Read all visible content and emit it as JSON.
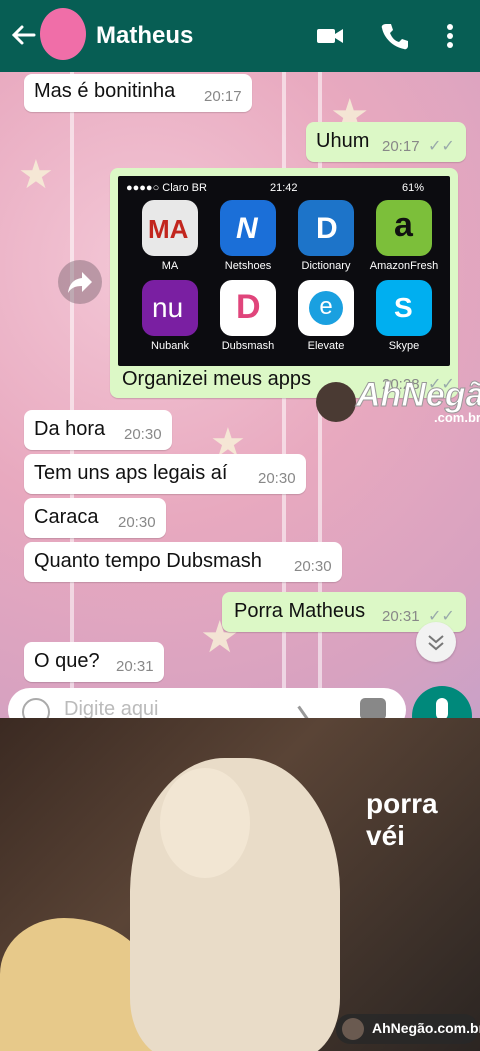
{
  "header": {
    "contact_name": "Matheus",
    "color": "#075e54",
    "icons": [
      "back-arrow-icon",
      "video-call-icon",
      "phone-icon",
      "more-options-icon"
    ]
  },
  "messages": [
    {
      "dir": "in",
      "text": "Mas é bonitinha",
      "time": "20:17"
    },
    {
      "dir": "out",
      "text": "Uhum",
      "time": "20:17",
      "ticks": "✓✓"
    },
    {
      "dir": "out",
      "text": "Organizei meus apps",
      "time": "20:28",
      "ticks": "✓✓",
      "has_image": true
    },
    {
      "dir": "in",
      "text": "Da hora",
      "time": "20:30"
    },
    {
      "dir": "in",
      "text": "Tem uns aps legais aí",
      "time": "20:30"
    },
    {
      "dir": "in",
      "text": "Caraca",
      "time": "20:30"
    },
    {
      "dir": "in",
      "text": "Quanto tempo Dubsmash",
      "time": "20:30"
    },
    {
      "dir": "out",
      "text": "Porra Matheus",
      "time": "20:31",
      "ticks": "✓✓"
    },
    {
      "dir": "in",
      "text": "O que?",
      "time": "20:31"
    }
  ],
  "phone_screenshot": {
    "carrier": "●●●●○ Claro BR",
    "clock": "21:42",
    "battery": "61%",
    "apps": [
      {
        "name": "MA",
        "icon": "MA",
        "color": "#e8e8e8"
      },
      {
        "name": "Netshoes",
        "icon": "N",
        "color": "#1b6fd8"
      },
      {
        "name": "Dictionary",
        "icon": "D",
        "color": "#1d74c9"
      },
      {
        "name": "AmazonFresh",
        "icon": "a",
        "color": "#7cbf3a"
      },
      {
        "name": "Nubank",
        "icon": "nu",
        "color": "#7a1fa2"
      },
      {
        "name": "Dubsmash",
        "icon": "D",
        "color": "#ffffff"
      },
      {
        "name": "Elevate",
        "icon": "e",
        "color": "#ffffff"
      },
      {
        "name": "Skype",
        "icon": "S",
        "color": "#00aff0"
      }
    ]
  },
  "input": {
    "placeholder": "Digite aqui"
  },
  "watermark": {
    "logo": "AhNegão!",
    "logo_sub": ".com.br",
    "bottom": "AhNegão.com.br"
  },
  "meme": {
    "caption": "porra véi"
  }
}
